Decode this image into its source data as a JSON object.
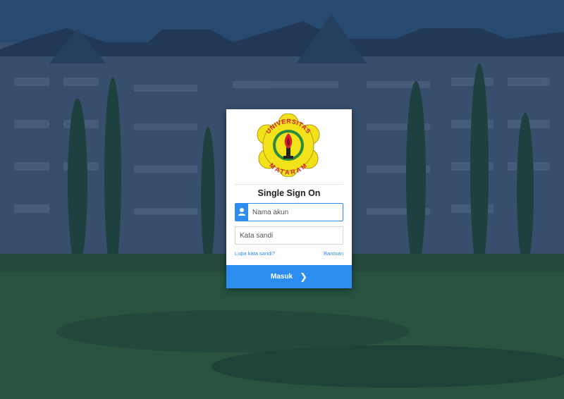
{
  "login": {
    "logo_top_text": "UNIVERSITAS",
    "logo_bottom_text": "MATARAM",
    "title": "Single Sign On",
    "username_placeholder": "Nama akun",
    "password_placeholder": "Kata sandi",
    "forgot_label": "Lupa kata sandi?",
    "help_label": "Bantuan",
    "submit_label": "Masuk",
    "submit_icon": "chevron-right-icon",
    "user_icon": "user-icon"
  },
  "colors": {
    "accent": "#2d8cf0",
    "logo_yellow": "#f2e21a",
    "logo_red": "#d4202a",
    "logo_green": "#2e8a3c",
    "overlay": "#0a2346"
  }
}
